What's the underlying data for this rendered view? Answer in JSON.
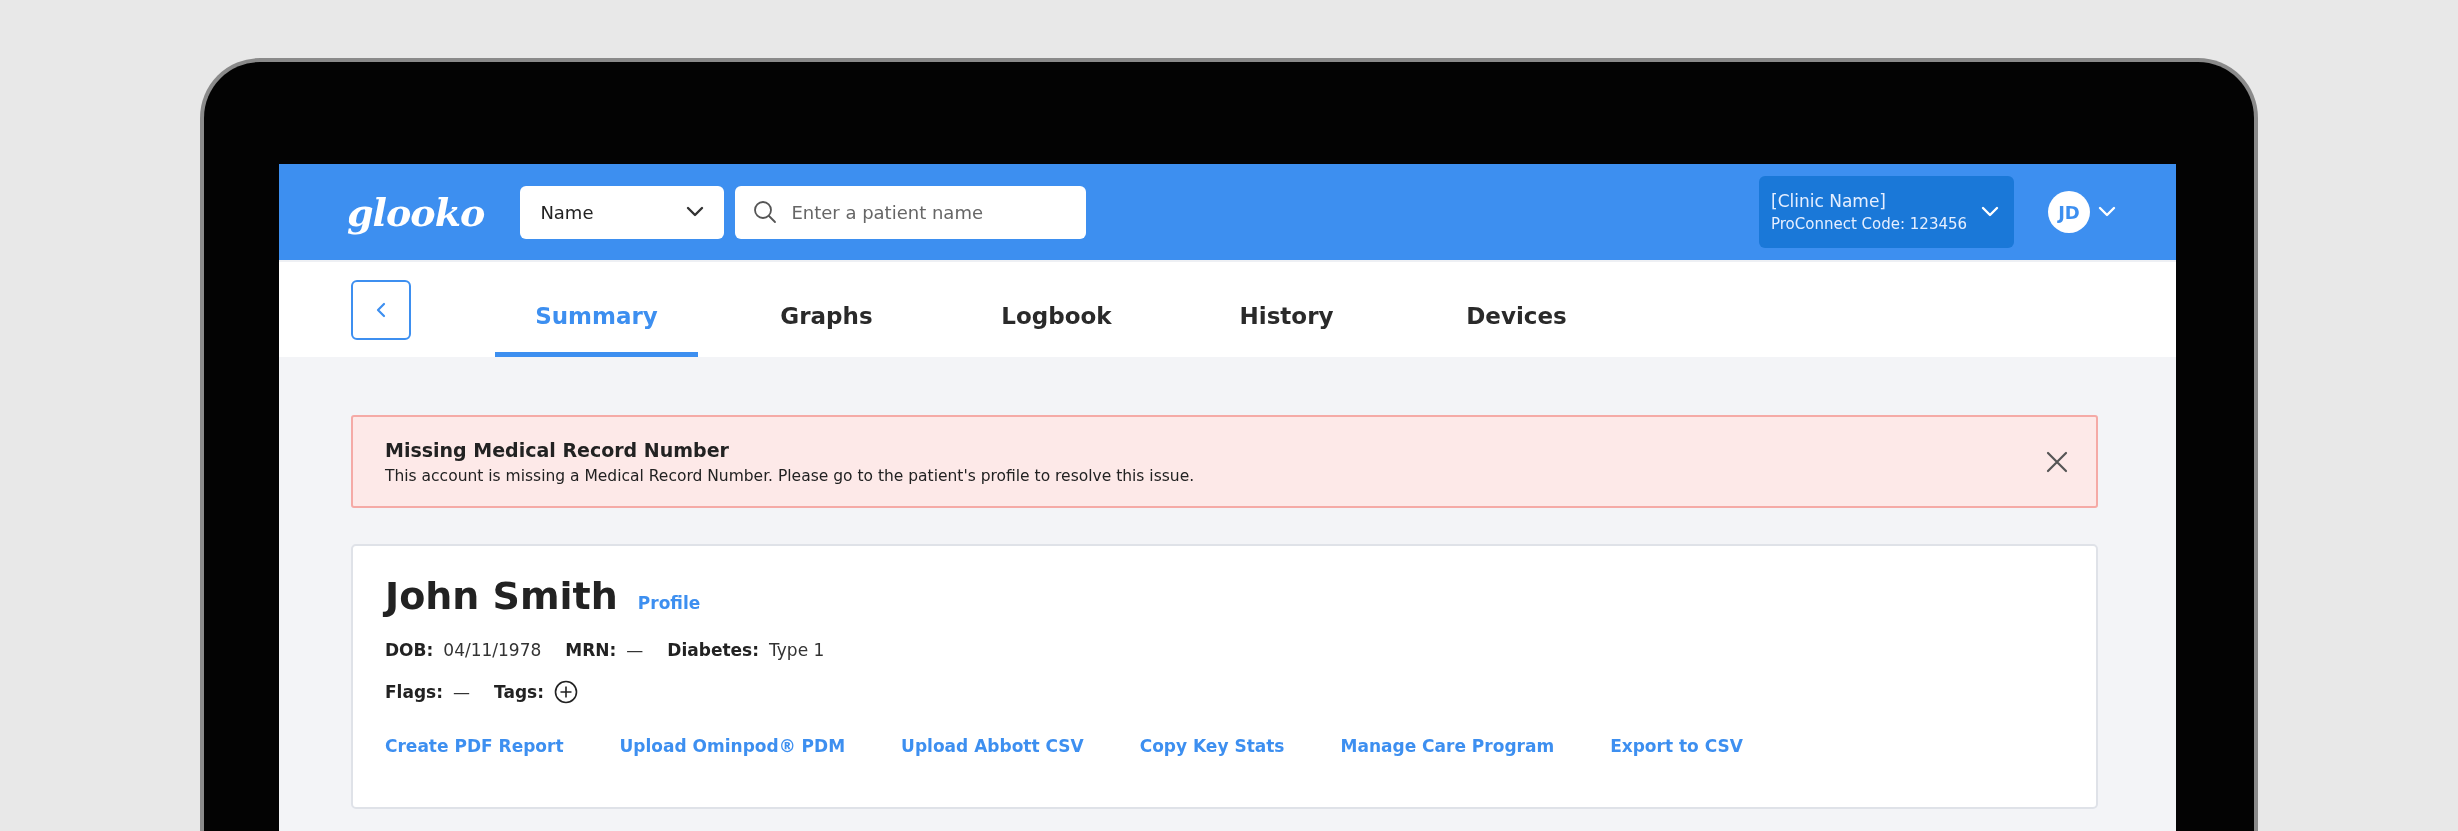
{
  "header": {
    "logo": "glooko",
    "search_by": "Name",
    "search": {
      "placeholder": "Enter a patient name"
    },
    "clinic": {
      "name": "[Clinic Name]",
      "code": "ProConnect Code: 123456"
    },
    "user_initials": "JD"
  },
  "tabs": [
    {
      "label": "Summary",
      "selected": true
    },
    {
      "label": "Graphs",
      "selected": false
    },
    {
      "label": "Logbook",
      "selected": false
    },
    {
      "label": "History",
      "selected": false
    },
    {
      "label": "Devices",
      "selected": false
    }
  ],
  "alert": {
    "title": "Missing Medical Record Number",
    "message": "This account is missing a Medical Record Number. Please go to the patient's profile to resolve this issue."
  },
  "patient": {
    "name": "John Smith",
    "profile_link": "Profile",
    "details": [
      {
        "label": "DOB:",
        "value": "04/11/1978"
      },
      {
        "label": "MRN:",
        "value": "—"
      },
      {
        "label": "Diabetes:",
        "value": "Type 1"
      }
    ],
    "flags": {
      "label": "Flags:",
      "value": "—"
    },
    "tags": {
      "label": "Tags:"
    },
    "actions": [
      "Create PDF Report",
      "Upload Ominpod® PDM",
      "Upload Abbott CSV",
      "Copy Key Stats",
      "Manage Care Program",
      "Export to CSV"
    ]
  }
}
